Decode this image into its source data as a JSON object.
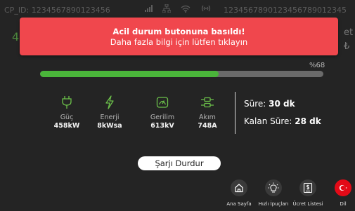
{
  "status_bar": {
    "cp_id": "CP_ID: 1234567890123456",
    "right_id": "1234567890123456789012345"
  },
  "background": {
    "left_glyph": "4",
    "right_line1": "et",
    "right_line2": "₺"
  },
  "alert": {
    "title": "Acil durum butonuna basıldı!",
    "subtitle": "Daha fazla bilgi için lütfen tıklayın"
  },
  "progress": {
    "percent_label": "%68",
    "fraction": 0.63
  },
  "metrics": [
    {
      "icon": "plug-icon",
      "label": "Güç",
      "value": "458kW"
    },
    {
      "icon": "bolt-icon",
      "label": "Enerji",
      "value": "8kWsa"
    },
    {
      "icon": "gauge-icon",
      "label": "Gerilim",
      "value": "613kV"
    },
    {
      "icon": "current-icon",
      "label": "Akım",
      "value": "748A"
    }
  ],
  "time": {
    "duration_label": "Süre:",
    "duration_value": "30 dk",
    "remaining_label": "Kalan Süre:",
    "remaining_value": "28 dk"
  },
  "stop_button_label": "Şarjı Durdur",
  "nav": [
    {
      "icon": "home-icon",
      "label": "Ana Sayfa"
    },
    {
      "icon": "lightbulb-icon",
      "label": "Hızlı İpuçları"
    },
    {
      "icon": "price-list-icon",
      "label": "Ücret Listesi"
    },
    {
      "icon": "turkey-flag-icon",
      "label": "Dil"
    }
  ],
  "colors": {
    "background": "#242424",
    "alert": "#f0474d",
    "progress_fill": "#4ab53a",
    "metric_icon": "#6cc04a",
    "flag": "#e30a17"
  }
}
